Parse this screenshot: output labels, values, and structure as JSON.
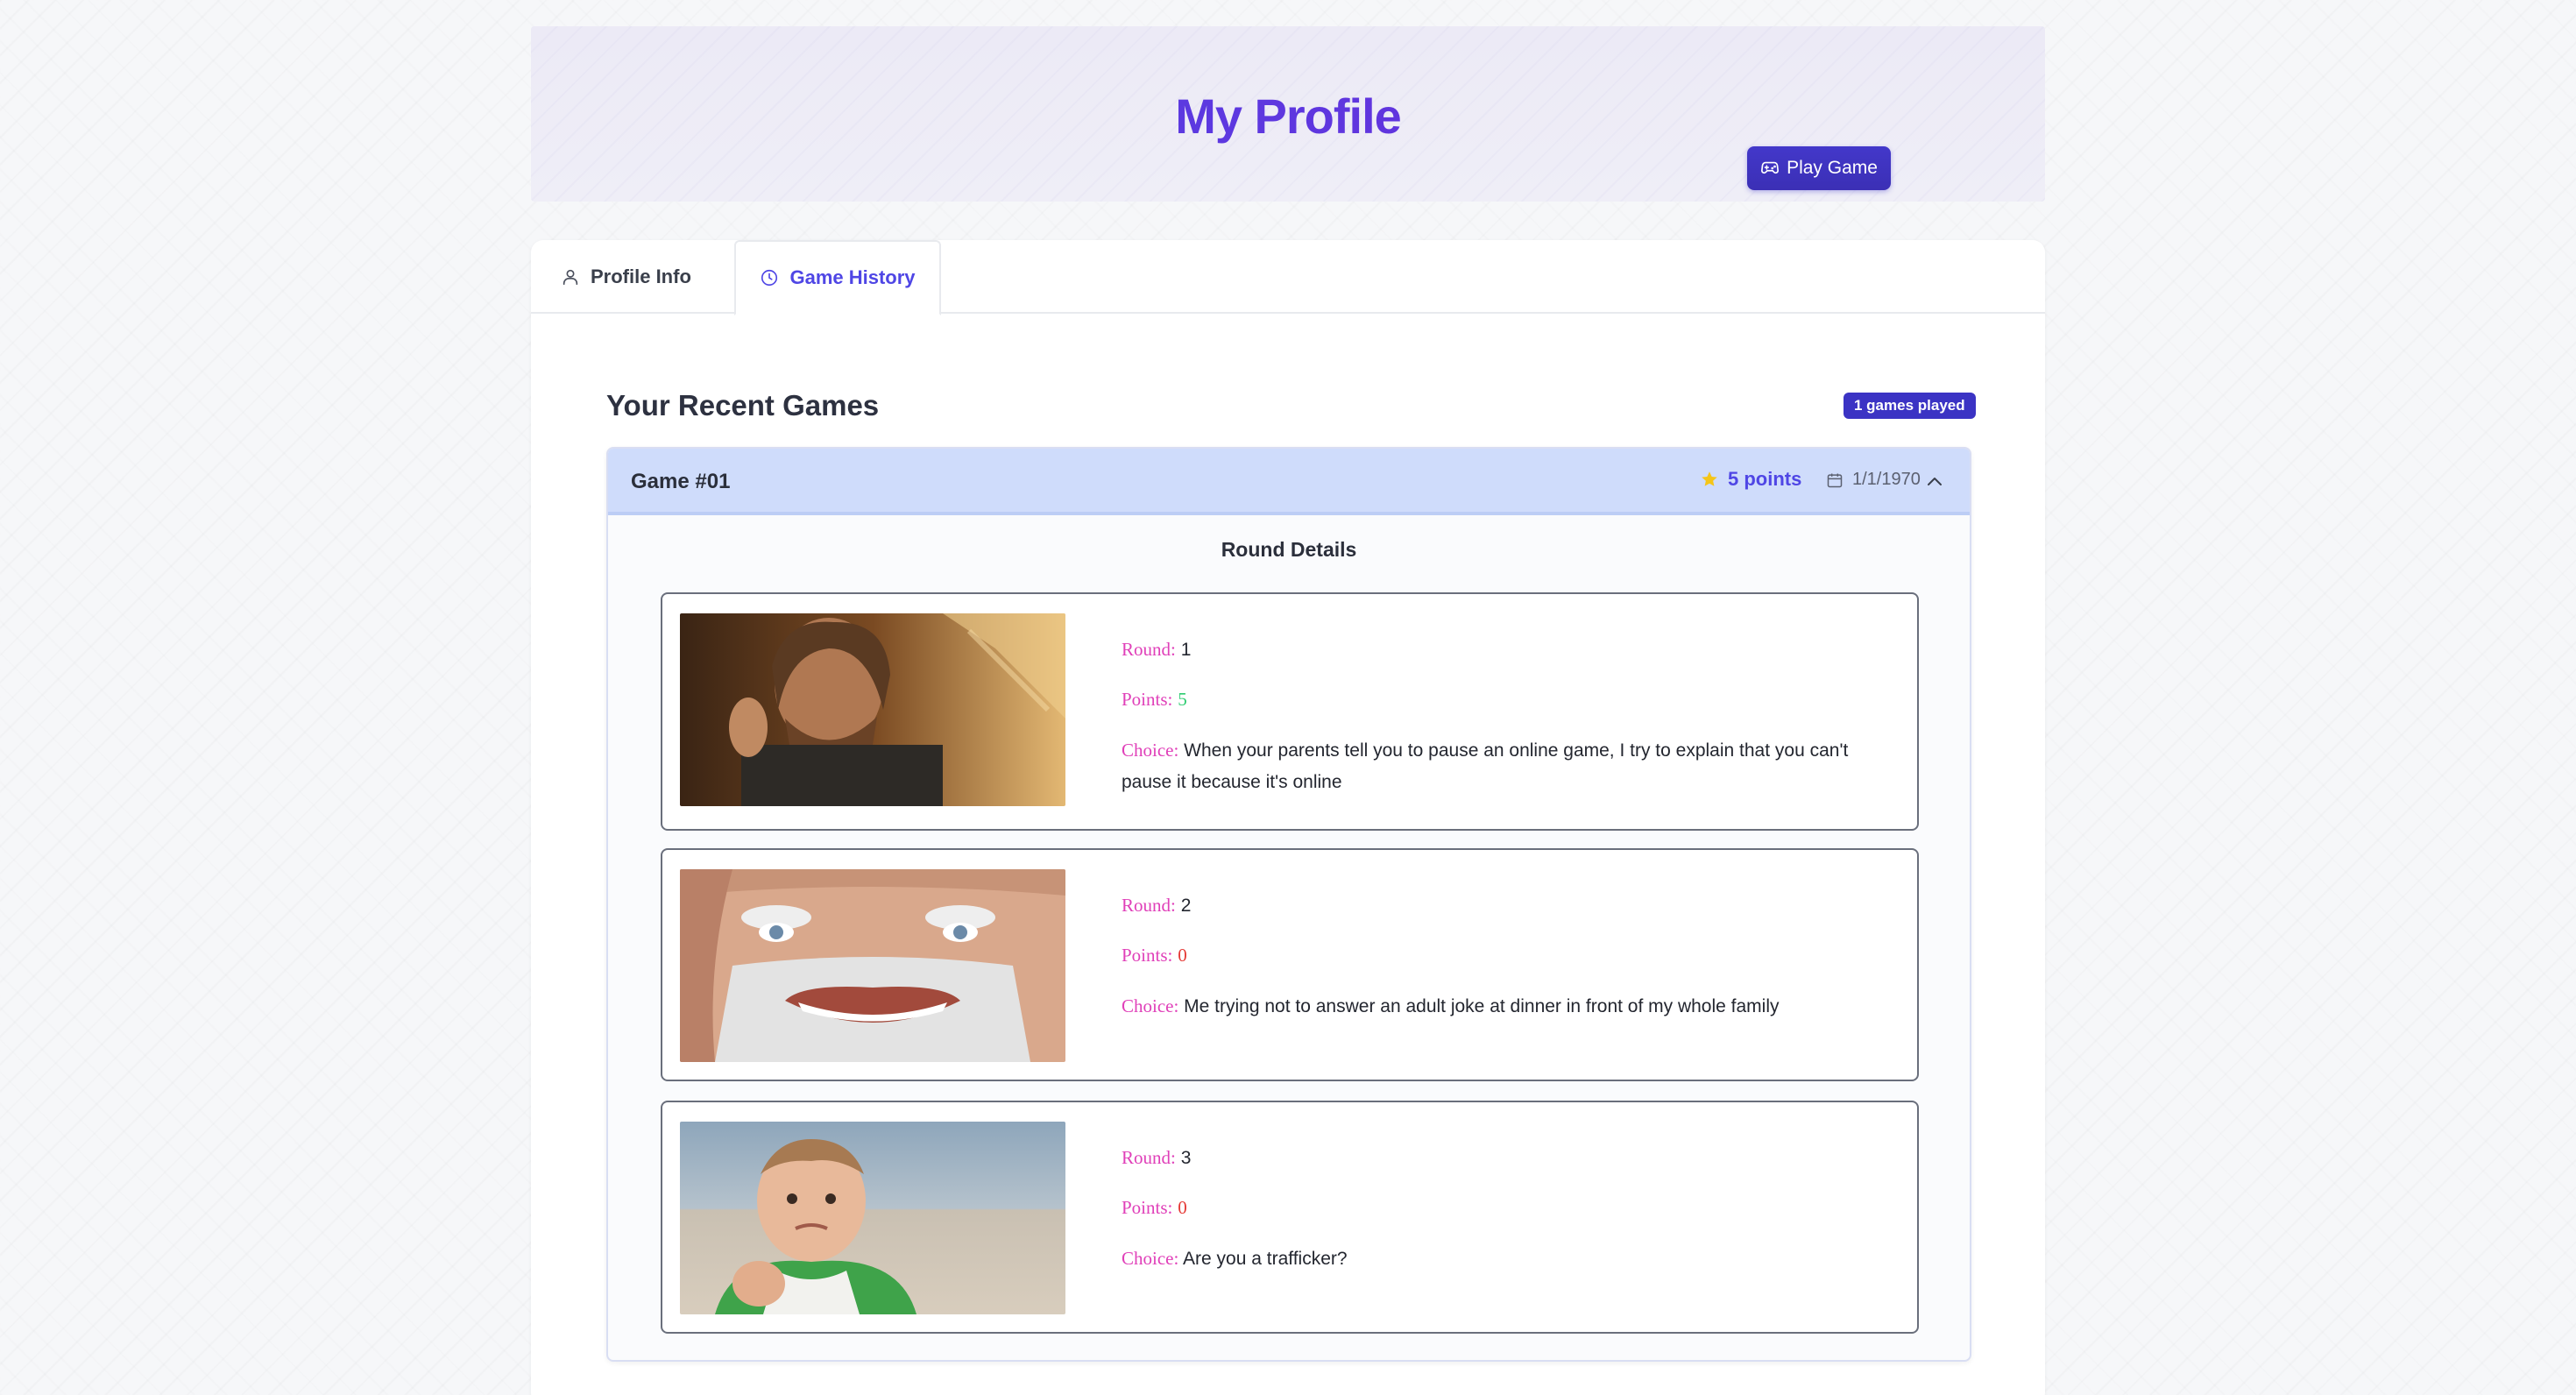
{
  "header": {
    "title": "My Profile",
    "play_button_label": "Play Game"
  },
  "tabs": [
    {
      "label": "Profile Info",
      "icon": "user-icon",
      "active": false
    },
    {
      "label": "Game History",
      "icon": "clock-icon",
      "active": true
    }
  ],
  "history": {
    "section_title": "Your Recent Games",
    "games_badge": "1 games played",
    "accent_color": "#4f46e5",
    "game": {
      "name": "Game #01",
      "points": "5 points",
      "date": "1/1/1970",
      "expanded": true,
      "round_details_title": "Round Details",
      "rounds": [
        {
          "round_label": "Round:",
          "round": "1",
          "points_label": "Points:",
          "points": "5",
          "choice_label": "Choice:",
          "choice": "When your parents tell you to pause an online game, I try to explain that you can't pause it because it's online"
        },
        {
          "round_label": "Round:",
          "round": "2",
          "points_label": "Points:",
          "points": "0",
          "choice_label": "Choice:",
          "choice": "Me trying not to answer an adult joke at dinner in front of my whole family"
        },
        {
          "round_label": "Round:",
          "round": "3",
          "points_label": "Points:",
          "points": "0",
          "choice_label": "Choice:",
          "choice": "Are you a trafficker?"
        }
      ]
    }
  }
}
